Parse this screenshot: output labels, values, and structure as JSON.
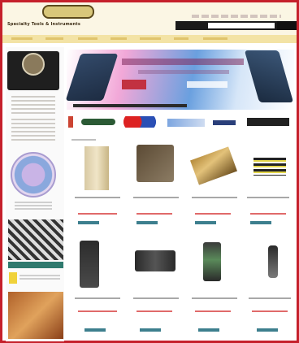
{
  "colors": {
    "frame": "#c5202b",
    "header_bg": "#fbf6e4",
    "nav_bg": "#f3e3a5",
    "button": "#3d7f8e",
    "price": "#e06a6a"
  },
  "header": {
    "logo_text": "Specialty Tools & Instruments"
  },
  "search": {
    "placeholder": ""
  },
  "icons": {
    "logo": "company-logo",
    "search": "search-button",
    "seal": "seal-icon",
    "certificate": "certificate-badge"
  },
  "products": [
    {
      "slot": 1,
      "icon": "tweezers-tool"
    },
    {
      "slot": 2,
      "icon": "tool-case"
    },
    {
      "slot": 3,
      "icon": "crimp-tool"
    },
    {
      "slot": 4,
      "icon": "probe-set"
    },
    {
      "slot": 5,
      "icon": "multimeter"
    },
    {
      "slot": 6,
      "icon": "tester-kit"
    },
    {
      "slot": 7,
      "icon": "handheld-meter"
    },
    {
      "slot": 8,
      "icon": "probe-tool"
    }
  ]
}
